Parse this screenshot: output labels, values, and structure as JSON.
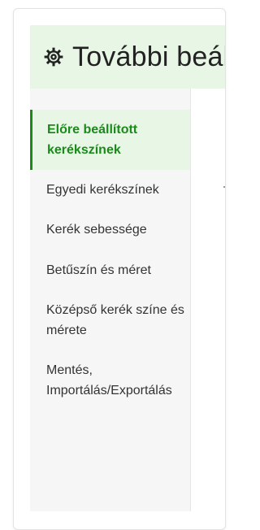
{
  "header": {
    "icon": "gear-icon",
    "title": "További beállítások"
  },
  "sidebar": {
    "items": [
      {
        "label": "Előre beállított kerékszínek",
        "active": true
      },
      {
        "label": "Egyedi kerékszínek",
        "active": false
      },
      {
        "label": "Kerék sebessége",
        "active": false
      },
      {
        "label": "Betűszín és méret",
        "active": false
      },
      {
        "label": "Középső kerék színe és mérete",
        "active": false
      },
      {
        "label": "Mentés, Importálás/Exportálás",
        "active": false
      }
    ]
  },
  "colors": {
    "accent": "#1a8a1a",
    "active_bg": "#e8f6e6",
    "sidebar_bg": "#f6f6f6"
  }
}
